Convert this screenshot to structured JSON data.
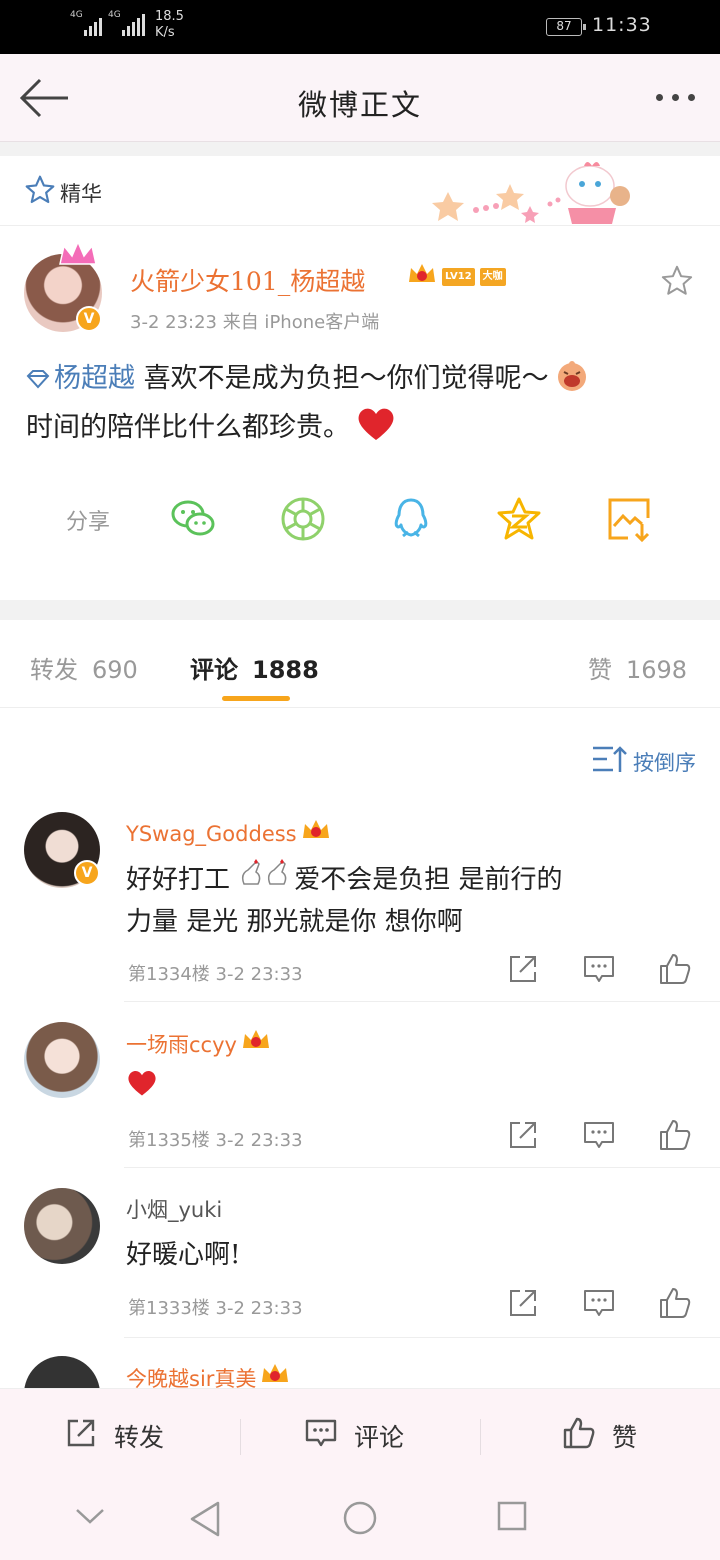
{
  "status_bar": {
    "network1": "4G",
    "network2": "4G",
    "speed_value": "18.5",
    "speed_unit": "K/s",
    "battery": "87",
    "time": "11:33"
  },
  "nav": {
    "title": "微博正文"
  },
  "essence": {
    "label": "精华"
  },
  "post": {
    "author": "火箭少女101_杨超越",
    "badge_level": "LV12",
    "badge_big": "大咖",
    "meta": "3-2 23:23  来自 iPhone客户端",
    "topic": "杨超越",
    "text1": " 喜欢不是成为负担～你们觉得呢～",
    "text2": "时间的陪伴比什么都珍贵。"
  },
  "share": {
    "label": "分享"
  },
  "tabs": [
    {
      "label": "转发",
      "count": "690"
    },
    {
      "label": "评论",
      "count": "1888"
    },
    {
      "label": "赞",
      "count": "1698"
    }
  ],
  "sort": {
    "label": "按倒序"
  },
  "comments": [
    {
      "name": "YSwag_Goddess",
      "line1": "好好打工 ",
      "line1b": "爱不会是负担 是前行的",
      "line2": "力量 是光 那光就是你 想你啊",
      "meta": "第1334楼 3-2 23:33"
    },
    {
      "name": "一场雨ccyy",
      "text": "",
      "meta": "第1335楼 3-2 23:33"
    },
    {
      "name": "小烟_yuki",
      "text": "好暖心啊!",
      "meta": "第1333楼 3-2 23:33"
    },
    {
      "name": "今晚越sir真美"
    }
  ],
  "actionbar": {
    "repost": "转发",
    "comment": "评论",
    "like": "赞"
  },
  "colors": {
    "accent": "#f7a51c",
    "name": "#eb7233",
    "topic": "#4b7eb8",
    "heart": "#e0252c"
  }
}
